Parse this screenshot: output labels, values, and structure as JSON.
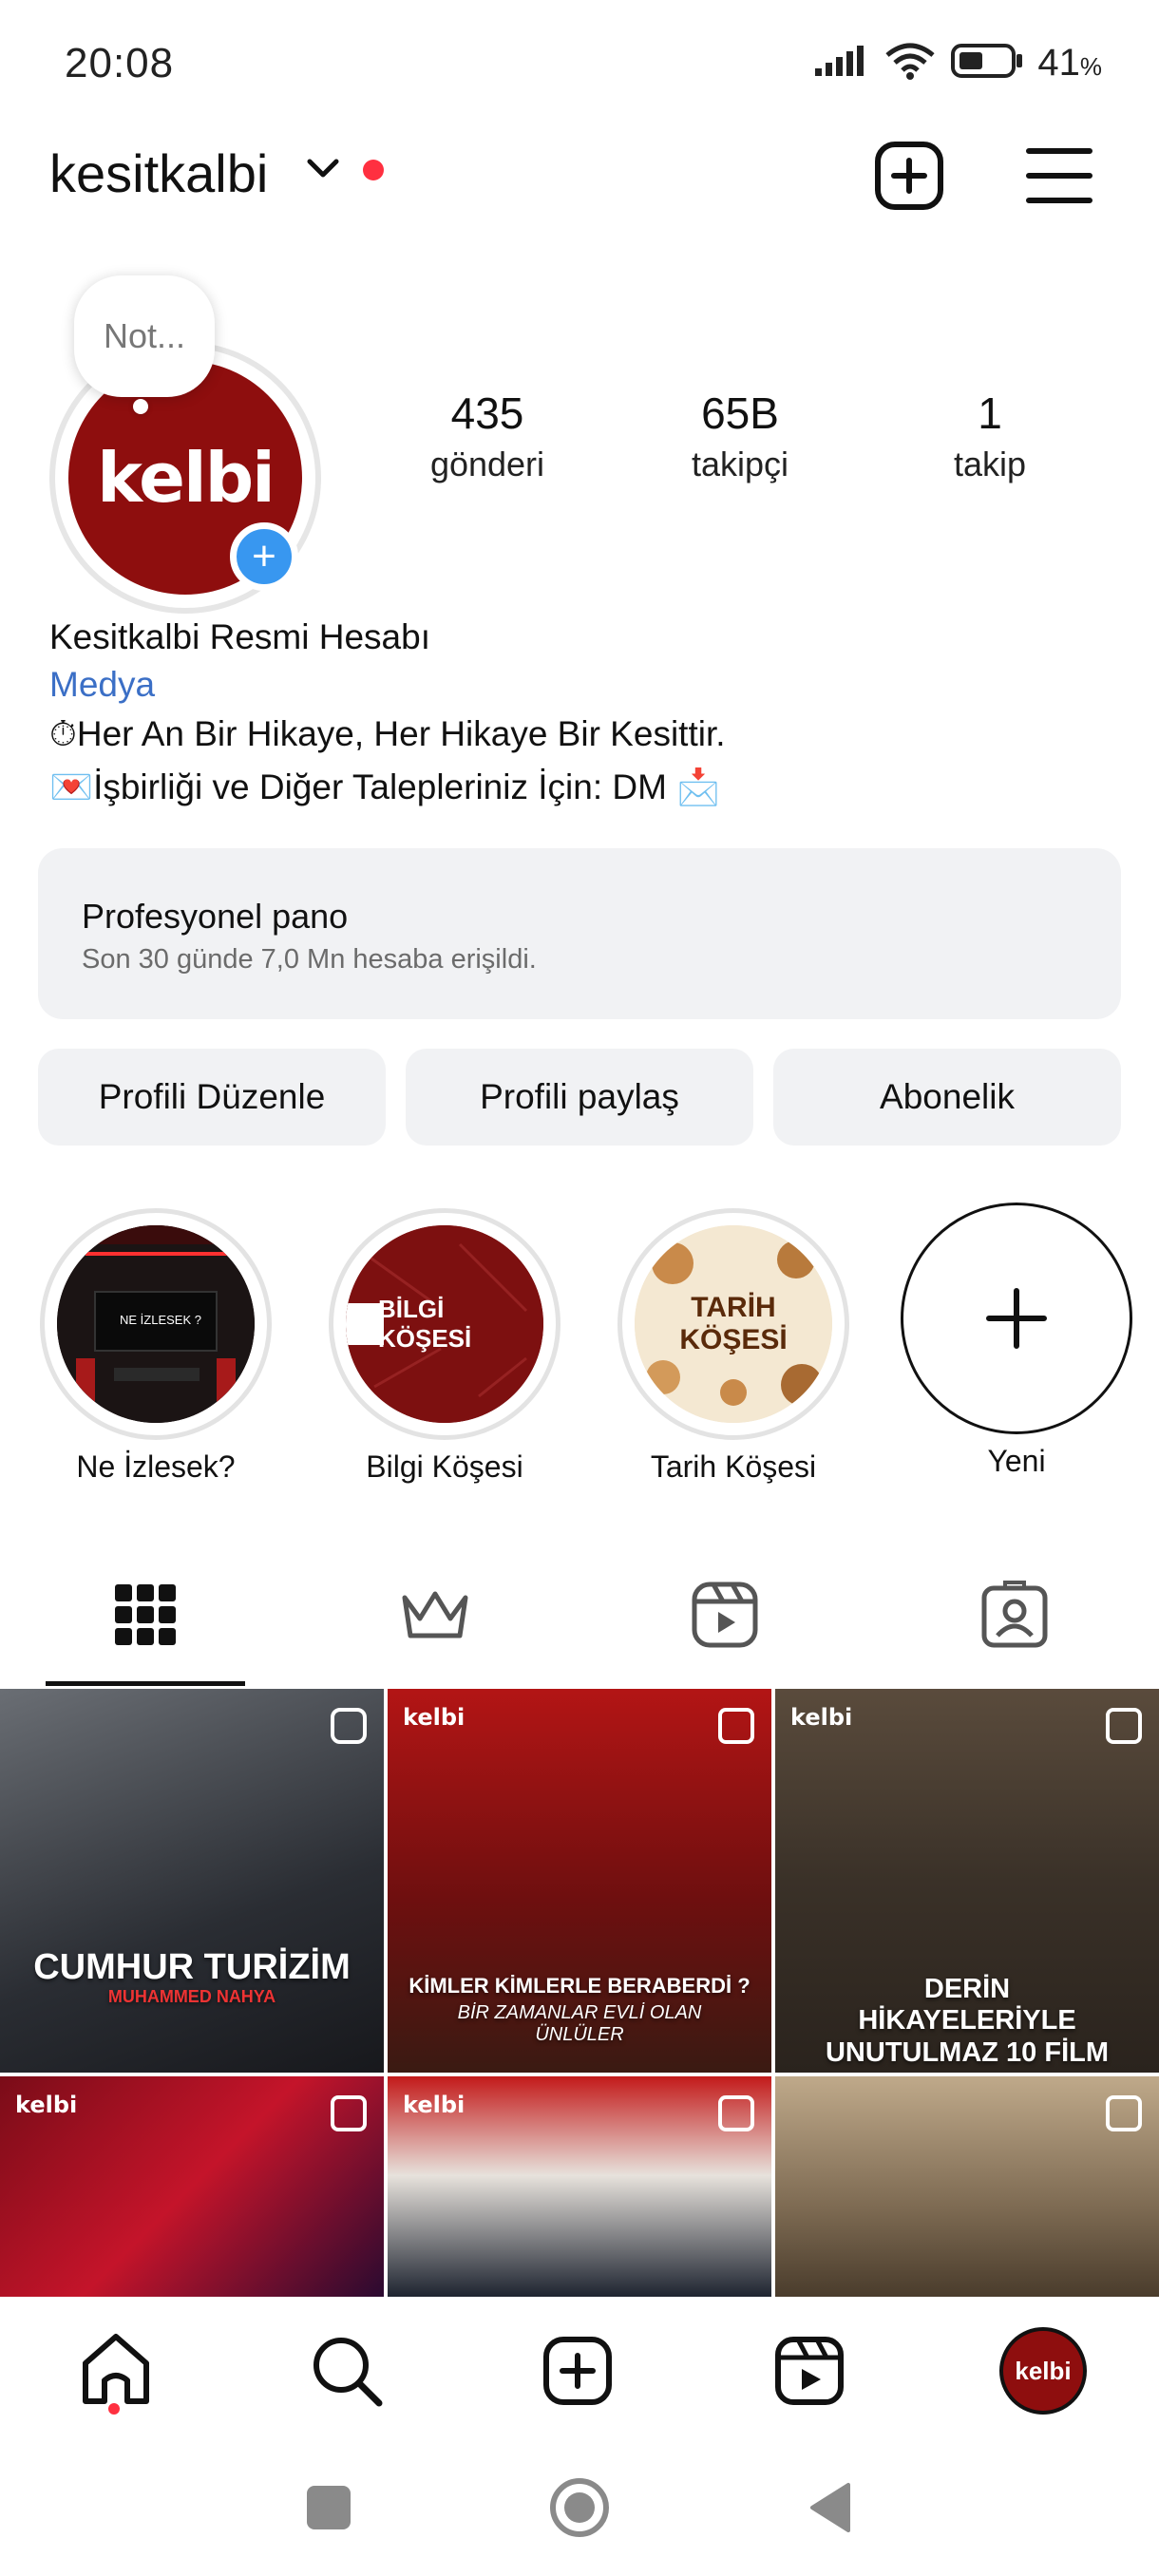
{
  "status_bar": {
    "time": "20:08",
    "battery": "41",
    "battery_unit": "%"
  },
  "header": {
    "username": "kesitkalbi"
  },
  "note": {
    "text": "Not..."
  },
  "avatar": {
    "logo_text": "kelbi"
  },
  "stats": [
    {
      "value": "435",
      "label": "gönderi"
    },
    {
      "value": "65B",
      "label": "takipçi"
    },
    {
      "value": "1",
      "label": "takip"
    }
  ],
  "bio": {
    "name": "Kesitkalbi Resmi Hesabı",
    "category": "Medya",
    "line1": "⏱Her An Bir Hikaye, Her Hikaye Bir Kesittir.",
    "line2": "💌İşbirliği ve Diğer Talepleriniz İçin: DM 📩"
  },
  "pro_dashboard": {
    "title": "Profesyonel pano",
    "subtitle": "Son 30 günde 7,0 Mn hesaba erişildi."
  },
  "buttons": {
    "edit": "Profili Düzenle",
    "share": "Profili paylaş",
    "subscribe": "Abonelik"
  },
  "highlights": [
    {
      "label": "Ne İzlesek?",
      "inner_text": "NE İZLESEK ?"
    },
    {
      "label": "Bilgi Köşesi",
      "inner_text": "BİLGİ KÖŞESİ"
    },
    {
      "label": "Tarih Köşesi",
      "inner_text": "TARİH KÖŞESİ"
    },
    {
      "label": "Yeni"
    }
  ],
  "grid": [
    {
      "caption": "CUMHUR TURİZİM",
      "sub": "MUHAMMED NAHYA",
      "logo": ""
    },
    {
      "caption": "KİMLER KİMLERLE BERABERDİ ?",
      "sub": "BİR ZAMANLAR EVLİ OLAN ÜNLÜLER",
      "logo": "kelbi"
    },
    {
      "caption": "DERİN HİKAYELERİYLE UNUTULMAZ 10 FİLM",
      "sub": "",
      "logo": "kelbi"
    },
    {
      "caption": "",
      "sub": "",
      "logo": "kelbi"
    },
    {
      "caption": "",
      "sub": "",
      "logo": "kelbi"
    },
    {
      "caption": "",
      "sub": "",
      "logo": ""
    }
  ],
  "bottom_nav": {
    "avatar_text": "kelbi"
  },
  "colors": {
    "accent_blue": "#3897f0",
    "notify_red": "#ff3040",
    "brand_red": "#8e0e0e",
    "link_blue": "#3b6fc6"
  }
}
